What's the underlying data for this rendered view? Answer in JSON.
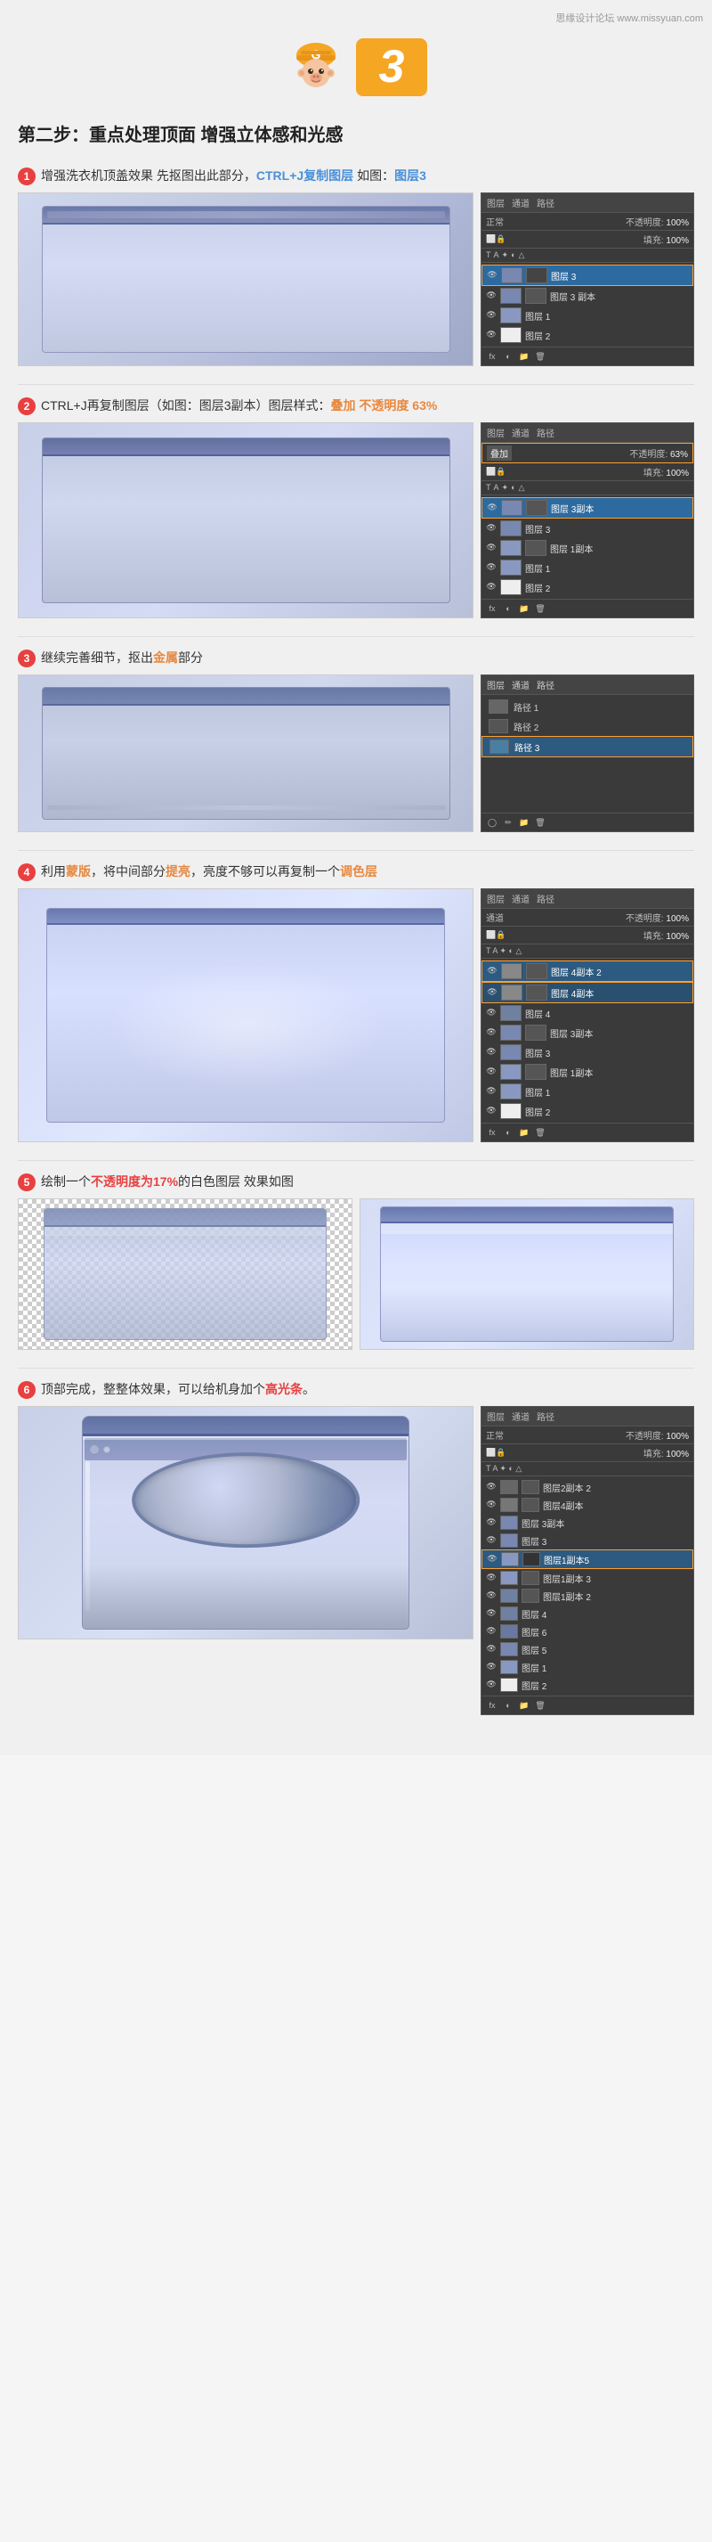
{
  "header": {
    "site": "思缘设计论坛 www.missyuan.com"
  },
  "step_indicator": {
    "step_number": "3",
    "monkey_alt": "monkey icon"
  },
  "section_title": "第二步：重点处理顶面 增强立体感和光感",
  "steps": [
    {
      "num": "1",
      "desc_parts": [
        {
          "text": "增强洗衣机顶盖效果 先抠图出此部分，CTRL+J复制图层 如图：图层3",
          "type": "normal"
        },
        {
          "text": "CTRL+J",
          "type": "highlight-blue"
        },
        {
          "text": "复制图层",
          "type": "highlight-blue"
        },
        {
          "text": "图层3",
          "type": "highlight-blue"
        }
      ],
      "full_desc": "增强洗衣机顶盖效果 先抠图出此部分，CTRL+J复制图层 如图：图层3",
      "panel_type": "layers",
      "active_layer": "图层 3"
    },
    {
      "num": "2",
      "full_desc": "CTRL+J再复制图层（如图：图层3副本）图层样式：叠加 不透明度 63%",
      "desc_highlight": [
        "叠加 不透明度 63%"
      ],
      "panel_type": "layers_blend",
      "blend_mode": "叠加",
      "opacity": "63%",
      "active_layer": "图层 3副本"
    },
    {
      "num": "3",
      "full_desc": "继续完善细节，抠出金属部分",
      "desc_highlight": [
        "金属"
      ],
      "panel_type": "paths",
      "active_path": "路径 3"
    },
    {
      "num": "4",
      "full_desc": "利用蒙版，将中间部分提亮，亮度不够可以再复制一个调色层",
      "desc_highlight": [
        "蒙版",
        "提亮",
        "调色层"
      ],
      "panel_type": "layers_multi"
    },
    {
      "num": "5",
      "full_desc": "绘制一个不透明度为17%的白色图层 效果如图",
      "desc_highlight": [
        "不透明度为17%"
      ],
      "two_images": true
    },
    {
      "num": "6",
      "full_desc": "顶部完成，整整体效果，可以给机身加个高光条。",
      "desc_highlight": [
        "高光条"
      ],
      "panel_type": "layers_full",
      "active_layer": "图层1副本5"
    }
  ],
  "ps_panels": {
    "panel1": {
      "tabs": [
        "图层",
        "通道",
        "路径"
      ],
      "blend": "正常",
      "opacity": "不透明度: 100%",
      "fill": "填充: 100%",
      "layers": [
        {
          "name": "图层 3",
          "active": true,
          "highlighted": true
        },
        {
          "name": "图层 3 副本",
          "active": false
        },
        {
          "name": "图层 1",
          "active": false
        },
        {
          "name": "图层 2",
          "active": false
        }
      ]
    },
    "panel2": {
      "tabs": [
        "图层",
        "通道",
        "路径"
      ],
      "blend": "叠加",
      "opacity": "不透明度: 63%",
      "fill": "填充: 100%",
      "layers": [
        {
          "name": "图层 3副本",
          "active": true,
          "highlighted": true
        },
        {
          "name": "图层 3",
          "active": false
        },
        {
          "name": "图层 1副本",
          "active": false
        },
        {
          "name": "图层 1",
          "active": false
        },
        {
          "name": "图层 2",
          "active": false
        }
      ]
    },
    "panel3": {
      "tabs": [
        "图层",
        "通道",
        "路径"
      ],
      "paths": [
        {
          "name": "路径 1",
          "active": false
        },
        {
          "name": "路径 2",
          "active": false
        },
        {
          "name": "路径 3",
          "active": true,
          "highlighted": true
        }
      ]
    },
    "panel4": {
      "tabs": [
        "图层",
        "通道",
        "路径"
      ],
      "blend": "通道",
      "opacity": "不透明度: 100%",
      "fill": "填充: 100%",
      "layers": [
        {
          "name": "图层 4副本 2",
          "active": true,
          "highlighted": true
        },
        {
          "name": "图层 4副本",
          "active": false,
          "highlighted": true
        },
        {
          "name": "图层 4",
          "active": false
        },
        {
          "name": "图层 3副本",
          "active": false
        },
        {
          "name": "图层 3",
          "active": false
        },
        {
          "name": "图层 1副本",
          "active": false
        },
        {
          "name": "图层 1",
          "active": false
        },
        {
          "name": "图层 2",
          "active": false
        }
      ]
    },
    "panel6": {
      "tabs": [
        "图层",
        "通道",
        "路径"
      ],
      "blend": "正常",
      "opacity": "不透明度: 100%",
      "fill": "填充: 100%",
      "layers": [
        {
          "name": "图层2副本 2",
          "active": false
        },
        {
          "name": "图层4副本",
          "active": false
        },
        {
          "name": "图层 3副本",
          "active": false
        },
        {
          "name": "图层 3",
          "active": false
        },
        {
          "name": "图层1副本5",
          "active": true,
          "highlighted": true
        },
        {
          "name": "图层1副本 3",
          "active": false
        },
        {
          "name": "图层1副本 2",
          "active": false
        },
        {
          "name": "图层 4",
          "active": false
        },
        {
          "name": "图层 6",
          "active": false
        },
        {
          "name": "图层 5",
          "active": false
        },
        {
          "name": "图层 1",
          "active": false
        },
        {
          "name": "图层 2",
          "active": false
        }
      ]
    }
  }
}
